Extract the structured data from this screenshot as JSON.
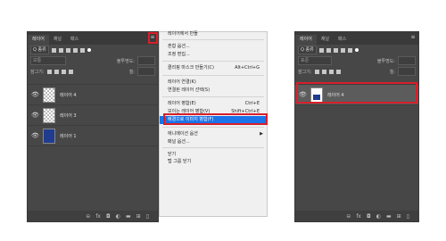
{
  "left_panel": {
    "tabs": [
      "레이어",
      "채널",
      "패스"
    ],
    "filter_kind": "Q 종류",
    "blend_mode": "보통",
    "opacity_label": "불투명도:",
    "fill_label": "칠:",
    "lock_label": "잠그기:",
    "layers": [
      {
        "name": "레이어 4",
        "thumb": "checker-icon"
      },
      {
        "name": "레이어 3",
        "thumb": "checker"
      },
      {
        "name": "레이어 1",
        "thumb": "solid"
      }
    ]
  },
  "menu": {
    "items": [
      {
        "label": "레이어에서 만들",
        "shortcut": "",
        "top": 0
      },
      {
        "label": "혼합 옵션...",
        "shortcut": ""
      },
      {
        "label": "조정 편집...",
        "shortcut": ""
      },
      {
        "label": "클리핑 마스크 만들기(C)",
        "shortcut": "Alt+Ctrl+G"
      },
      {
        "label": "레이어 연결(K)",
        "shortcut": ""
      },
      {
        "label": "연결된 레이어 선택(S)",
        "shortcut": ""
      },
      {
        "label": "레이어 병합(E)",
        "shortcut": "Ctrl+E"
      },
      {
        "label": "보이는 레이어 병합(V)",
        "shortcut": "Shift+Ctrl+E"
      },
      {
        "label": "배경으로 이미지 병합(F)",
        "shortcut": "",
        "highlighted": true
      },
      {
        "label": "애니메이션 옵션",
        "shortcut": "",
        "submenu": true
      },
      {
        "label": "패널 옵션...",
        "shortcut": ""
      },
      {
        "label": "닫기",
        "shortcut": ""
      },
      {
        "label": "탭 그룹 닫기",
        "shortcut": ""
      }
    ]
  },
  "right_panel": {
    "tabs": [
      "레이어",
      "채널",
      "패스"
    ],
    "filter_kind": "Q 종류",
    "blend_mode": "표준",
    "opacity_label": "불투명도:",
    "fill_label": "칠:",
    "lock_label": "잠그기:",
    "layers": [
      {
        "name": "레이어 4",
        "thumb": "white"
      }
    ]
  },
  "colors": {
    "highlight": "#1a73e8",
    "annotation_red": "#d81f2b",
    "panel_bg": "#474747"
  }
}
